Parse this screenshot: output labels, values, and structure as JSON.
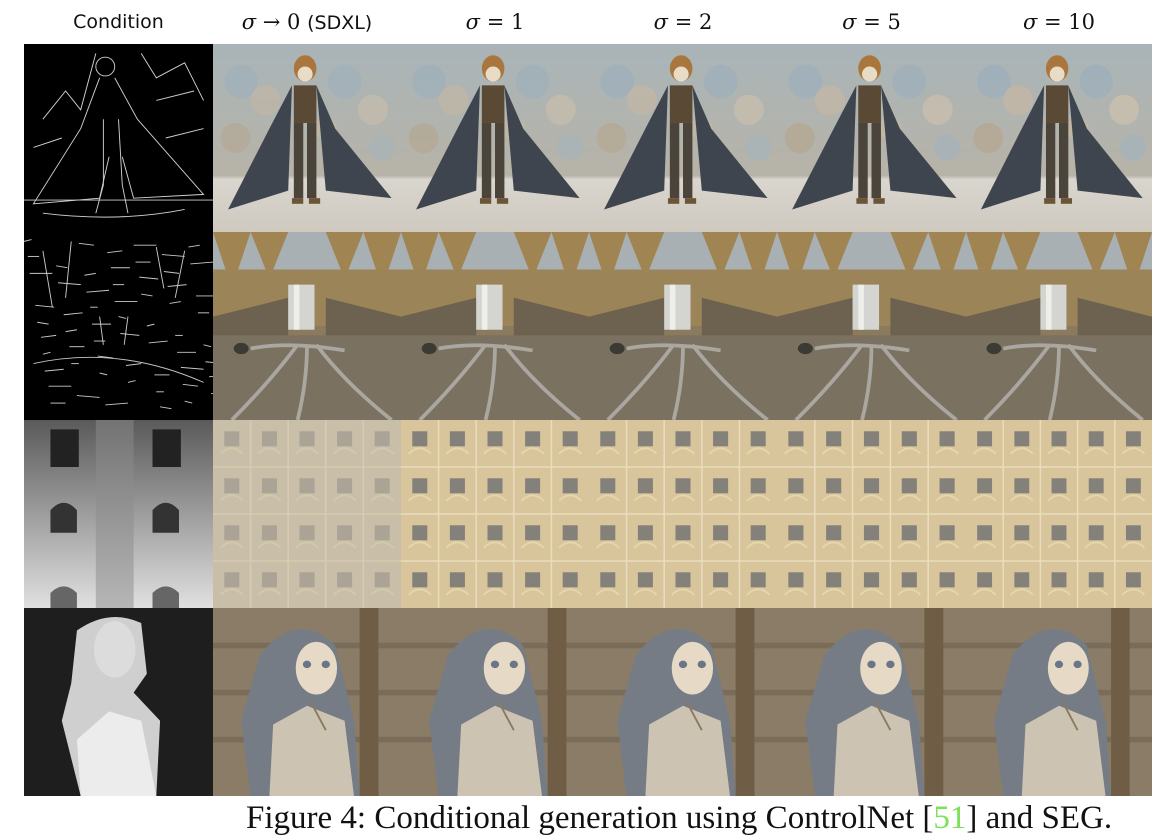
{
  "figure": {
    "column_headers": [
      {
        "id": "condition",
        "label": "Condition"
      },
      {
        "id": "sigma-0",
        "symbol": "σ",
        "rest": " → 0 ",
        "suffix": "(SDXL)"
      },
      {
        "id": "sigma-1",
        "symbol": "σ",
        "rest": " = 1"
      },
      {
        "id": "sigma-2",
        "symbol": "σ",
        "rest": " = 2"
      },
      {
        "id": "sigma-5",
        "symbol": "σ",
        "rest": " = 5"
      },
      {
        "id": "sigma-10",
        "symbol": "σ",
        "rest": " = 10"
      }
    ],
    "rows": [
      {
        "id": "row-anime-boy",
        "condition": "canny edge map",
        "subject": "anime boy in dark coat"
      },
      {
        "id": "row-waterfall",
        "condition": "canny edge map",
        "subject": "forest waterfall"
      },
      {
        "id": "row-facade",
        "condition": "depth map",
        "subject": "ornate building facade"
      },
      {
        "id": "row-anime-girl",
        "condition": "depth map",
        "subject": "anime girl portrait"
      }
    ],
    "caption": {
      "prefix": "Figure 4: Conditional generation using ControlNet [",
      "citation": "51",
      "suffix": "] and SEG."
    },
    "colors": {
      "citation": "#7be05a"
    }
  }
}
